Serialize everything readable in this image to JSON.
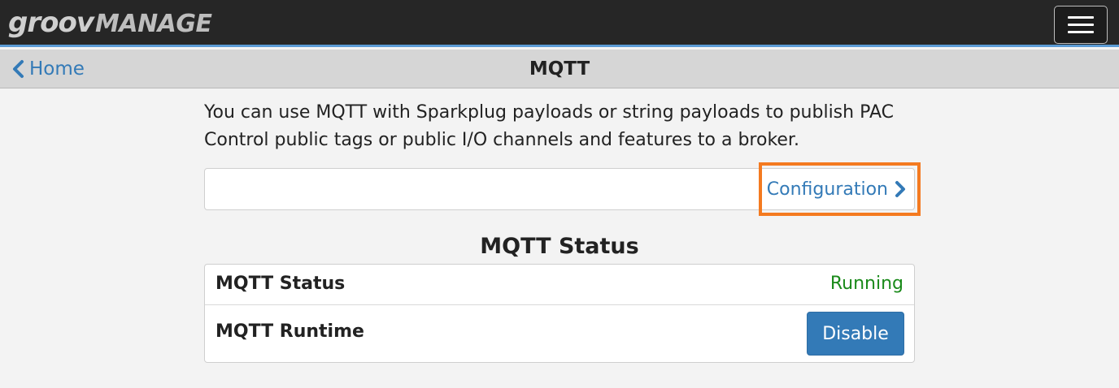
{
  "app": {
    "logo_part1": "groov",
    "logo_part2": "MANAGE",
    "menu_icon": "hamburger-icon"
  },
  "nav": {
    "back_label": "Home",
    "back_icon": "chevron-left-icon",
    "title": "MQTT"
  },
  "main": {
    "intro_text": "You can use MQTT with Sparkplug payloads or string payloads to publish PAC Control public tags or public I/O channels and features to a broker.",
    "config_link_label": "Configuration",
    "config_link_icon": "chevron-right-icon",
    "highlight_color": "#f47a20",
    "section_title": "MQTT Status",
    "status_rows": [
      {
        "label": "MQTT Status",
        "value": "Running",
        "value_color": "#1a8a1a"
      },
      {
        "label": "MQTT Runtime",
        "button_label": "Disable"
      }
    ]
  },
  "colors": {
    "topbar_bg": "#262626",
    "accent_blue": "#337ab7",
    "navbar_bg": "#d6d6d6"
  }
}
